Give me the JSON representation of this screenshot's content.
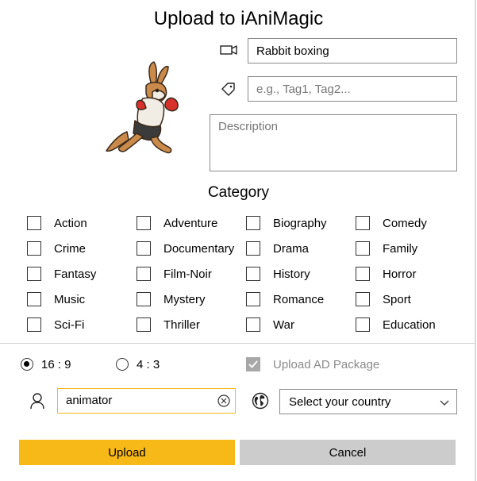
{
  "dialog": {
    "title": "Upload to iAniMagic"
  },
  "icons": {
    "video": "video-camera-icon",
    "tag": "tag-icon",
    "user": "person-icon",
    "globe": "globe-icon",
    "clear": "clear-circle-icon",
    "chevron": "chevron-down-icon"
  },
  "form": {
    "name_value": "Rabbit boxing",
    "tags_placeholder": "e.g., Tag1, Tag2...",
    "description_placeholder": "Description"
  },
  "category": {
    "title": "Category",
    "items": [
      "Action",
      "Adventure",
      "Biography",
      "Comedy",
      "Crime",
      "Documentary",
      "Drama",
      "Family",
      "Fantasy",
      "Film-Noir",
      "History",
      "Horror",
      "Music",
      "Mystery",
      "Romance",
      "Sport",
      "Sci-Fi",
      "Thriller",
      "War",
      "Education"
    ]
  },
  "options": {
    "ratio_169": "16 : 9",
    "ratio_43": "4 : 3",
    "ratio_selected": "16 : 9",
    "ad_package_label": "Upload AD Package",
    "ad_package_checked": true,
    "ad_package_enabled": false
  },
  "user": {
    "value": "animator"
  },
  "country": {
    "selected": "Select your country"
  },
  "buttons": {
    "upload": "Upload",
    "cancel": "Cancel"
  },
  "colors": {
    "accent": "#f7b918",
    "cancel_bg": "#cccccc",
    "border": "#8a8a8a",
    "disabled": "#a8a8a8"
  }
}
